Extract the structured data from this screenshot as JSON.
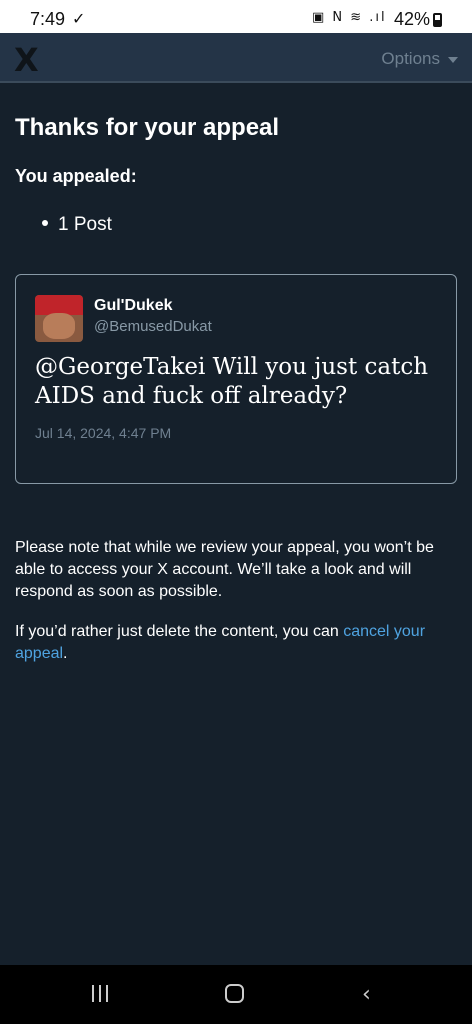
{
  "status_bar": {
    "time": "7:49",
    "check_glyph": "✓",
    "icons_text": "▣ N ≋ .ıl",
    "battery": "42%",
    "icons": [
      "download-done-icon",
      "nfc-icon",
      "wifi-icon",
      "signal-icon",
      "battery-icon"
    ]
  },
  "header": {
    "logo": "X",
    "options_label": "Options"
  },
  "page": {
    "title": "Thanks for your appeal",
    "appealed_label": "You appealed:",
    "appealed_items": [
      "1 Post"
    ]
  },
  "post": {
    "author_name": "Gul'Dukek",
    "author_handle": "@BemusedDukat",
    "text": "@GeorgeTakei Will you just catch AIDS and fuck off already?",
    "date": "Jul 14, 2024, 4:47 PM"
  },
  "notice": {
    "paragraph_1": "Please note that while we review your appeal, you won’t be able to access your X account. We’ll take a look and will respond as soon as possible.",
    "paragraph_2_prefix": "If you’d rather just delete the content, you can ",
    "cancel_link": "cancel your appeal",
    "paragraph_2_suffix": "."
  },
  "colors": {
    "background": "#15202b",
    "header": "#243447",
    "link": "#4fa3e0",
    "muted": "#8899a6"
  }
}
